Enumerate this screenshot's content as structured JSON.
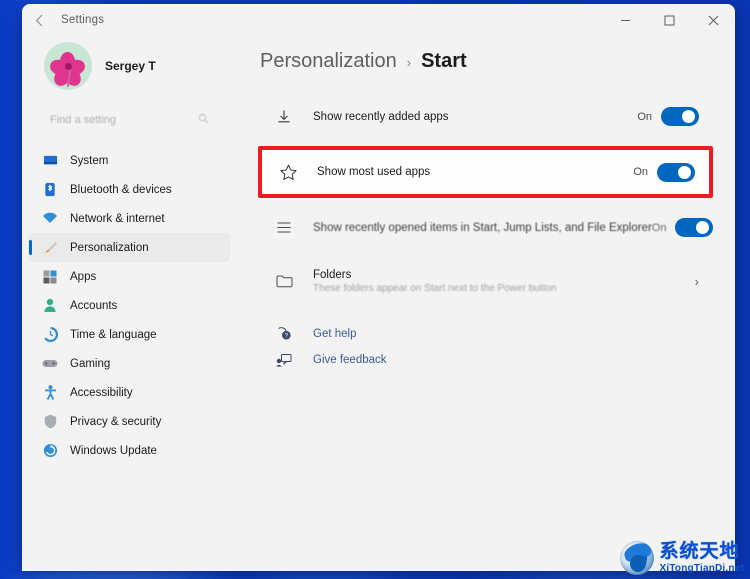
{
  "window": {
    "titlebar_title": "Settings",
    "back_icon": "chevron-left-icon",
    "minimize_label": "–",
    "maximize_label": "□",
    "close_label": "✕"
  },
  "account": {
    "name": "Sergey T",
    "avatar_icon": "flower-avatar"
  },
  "search": {
    "value": "",
    "placeholder": "Find a setting",
    "icon": "search-icon"
  },
  "sidebar": {
    "items": [
      {
        "label": "System",
        "icon": "system-icon",
        "selected": false
      },
      {
        "label": "Bluetooth & devices",
        "icon": "bluetooth-icon",
        "selected": false
      },
      {
        "label": "Network & internet",
        "icon": "network-icon",
        "selected": false
      },
      {
        "label": "Personalization",
        "icon": "personalization-icon",
        "selected": true
      },
      {
        "label": "Apps",
        "icon": "apps-icon",
        "selected": false
      },
      {
        "label": "Accounts",
        "icon": "accounts-icon",
        "selected": false
      },
      {
        "label": "Time & language",
        "icon": "time-language-icon",
        "selected": false
      },
      {
        "label": "Gaming",
        "icon": "gaming-icon",
        "selected": false
      },
      {
        "label": "Accessibility",
        "icon": "accessibility-icon",
        "selected": false
      },
      {
        "label": "Privacy & security",
        "icon": "shield-icon",
        "selected": false
      },
      {
        "label": "Windows Update",
        "icon": "windows-update-icon",
        "selected": false
      }
    ]
  },
  "breadcrumb": {
    "parent": "Personalization",
    "separator": "›",
    "current": "Start"
  },
  "settings": {
    "recently_added": {
      "label": "Show recently added apps",
      "icon": "download-icon",
      "state": "On"
    },
    "most_used": {
      "label": "Show most used apps",
      "icon": "star-icon",
      "state": "On",
      "highlighted": true
    },
    "recently_opened": {
      "label": "Show recently opened items in Start, Jump Lists, and File Explorer",
      "icon": "list-icon",
      "state": "On"
    },
    "folders": {
      "label": "Folders",
      "sublabel": "These folders appear on Start next to the Power button",
      "icon": "folder-icon",
      "chevron": "›"
    }
  },
  "links": [
    {
      "label": "Get help",
      "icon": "help-icon"
    },
    {
      "label": "Give feedback",
      "icon": "feedback-icon"
    }
  ],
  "watermark": {
    "chinese": "系统天地",
    "english": "XiTongTianDi.net",
    "logo_icon": "globe-logo-icon"
  },
  "colors": {
    "accent": "#0067c0",
    "highlight_box": "#ec1c24",
    "desktop": "#0b3fc4",
    "window_bg": "#f3f3f3"
  }
}
